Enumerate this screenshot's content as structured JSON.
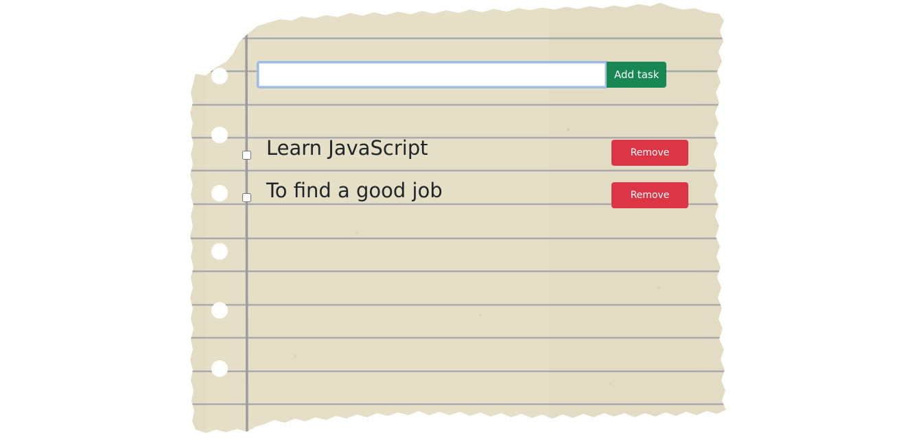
{
  "form": {
    "input_value": "",
    "input_placeholder": "",
    "add_label": "Add task"
  },
  "tasks": [
    {
      "text": "Learn JavaScript",
      "done": false,
      "remove_label": "Remove"
    },
    {
      "text": "To find a good job",
      "done": false,
      "remove_label": "Remove"
    }
  ],
  "colors": {
    "paper": "#e3dcc4",
    "rule_line": "#a19fa6",
    "margin_line": "#9c9aa3",
    "add_button": "#198754",
    "remove_button": "#dc3545",
    "text": "#212529"
  }
}
